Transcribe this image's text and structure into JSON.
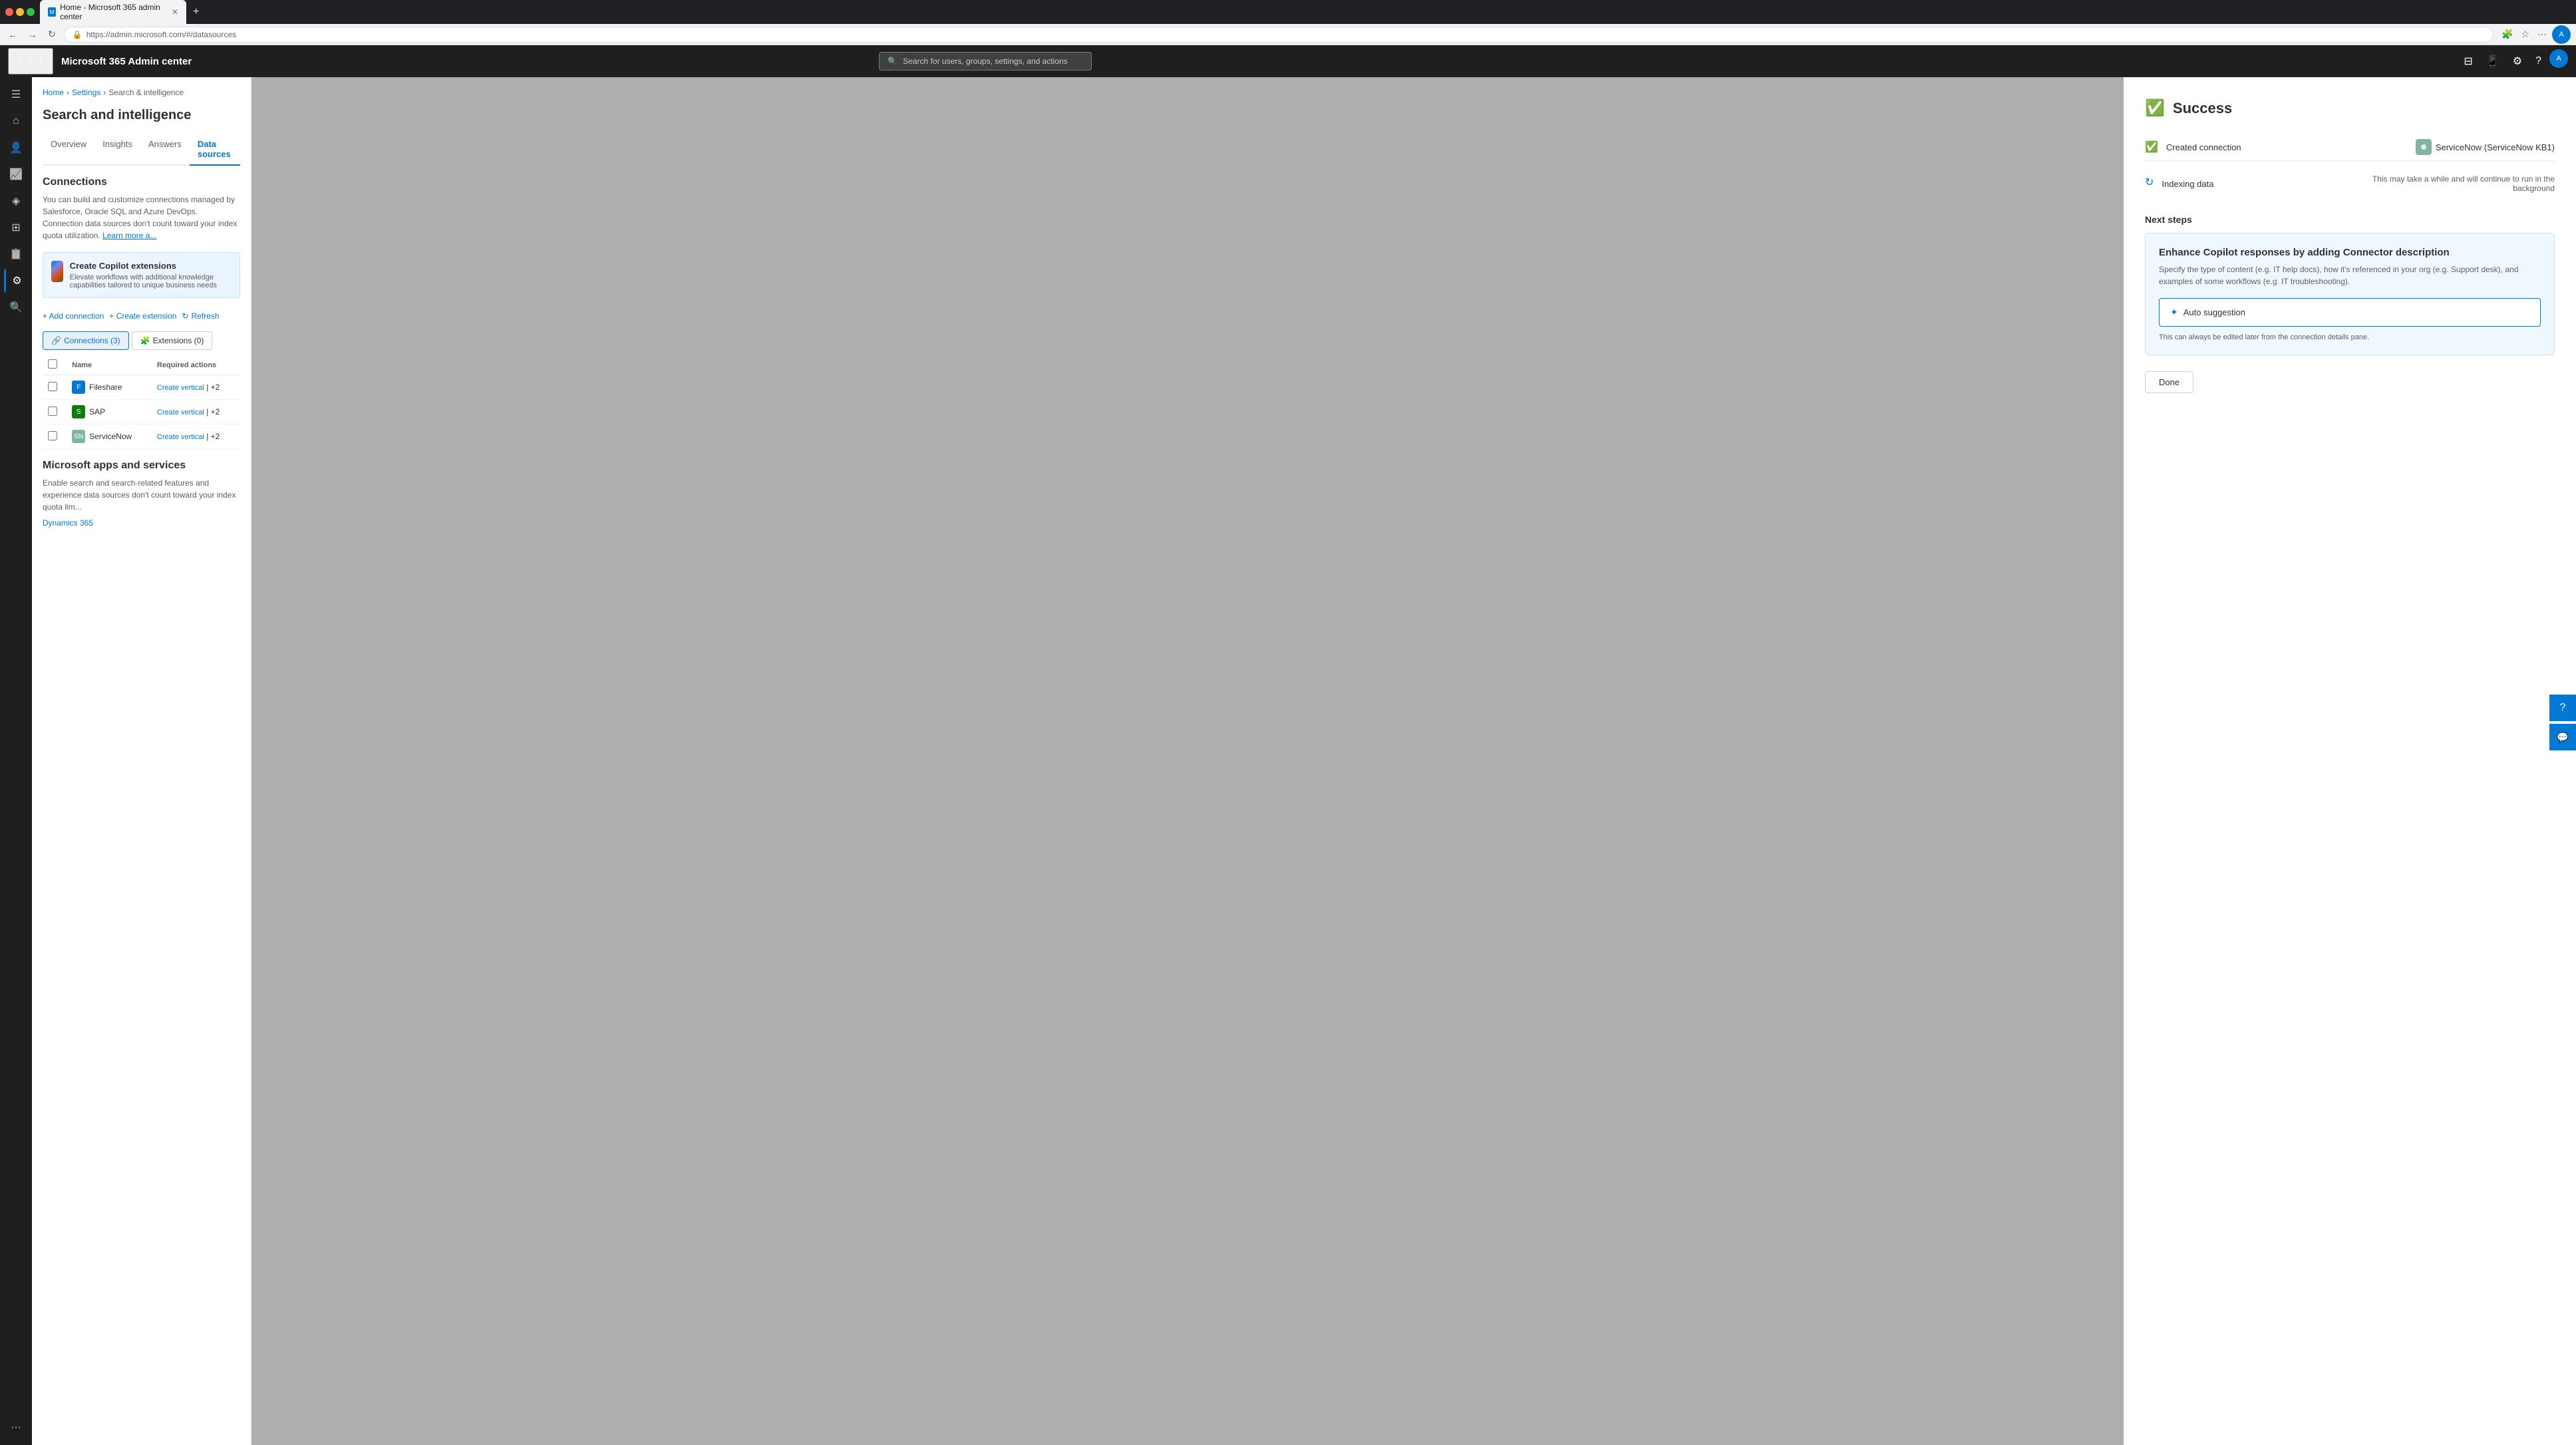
{
  "browser": {
    "url": "https://admin.microsoft.com/#/datasources",
    "tab_title": "Home - Microsoft 365 admin center",
    "tab_favicon": "M"
  },
  "top_nav": {
    "app_title": "Microsoft 365 Admin center",
    "search_placeholder": "Search for users, groups, settings, and actions",
    "avatar_initials": "A"
  },
  "breadcrumb": {
    "home": "Home",
    "settings": "Settings",
    "search_intelligence": "Search & intelligence"
  },
  "page": {
    "title": "Search and intelligence",
    "tabs": [
      {
        "label": "Overview",
        "active": false
      },
      {
        "label": "Insights",
        "active": false
      },
      {
        "label": "Answers",
        "active": false
      },
      {
        "label": "Data sources",
        "active": true
      }
    ]
  },
  "connections_section": {
    "title": "Connections",
    "description": "You can build and customize connections managed by Salesforce, Oracle SQL and Azure DevOps. Connection data sources don't count toward your index quota utilization.",
    "learn_more": "Learn more a..."
  },
  "promo_banner": {
    "title": "Create Copilot extensions",
    "description": "Elevate workflows with additional knowledge capabilities tailored to unique business needs"
  },
  "action_bar": {
    "add_connection": "+ Add connection",
    "create_extension": "+ Create extension",
    "refresh": "Refresh"
  },
  "sub_tabs": [
    {
      "label": "Connections (3)",
      "active": true
    },
    {
      "label": "Extensions (0)",
      "active": false
    }
  ],
  "table": {
    "headers": [
      "",
      "Name",
      "Required actions"
    ],
    "rows": [
      {
        "name": "Fileshare",
        "icon_color": "#0078d4",
        "icon_letter": "F",
        "action": "Create vertical",
        "action_extra": "| +2"
      },
      {
        "name": "SAP",
        "icon_color": "#107c10",
        "icon_letter": "S",
        "action": "Create vertical",
        "action_extra": "| +2"
      },
      {
        "name": "ServiceNow",
        "icon_color": "#81b5a1",
        "icon_letter": "SN",
        "action": "Create vertical",
        "action_extra": "| +2"
      }
    ]
  },
  "ms_apps": {
    "title": "Microsoft apps and services",
    "description": "Enable search and search-related features and experience data sources don't count toward your index quota lim...",
    "dynamics_link": "Dynamics 365"
  },
  "modal": {
    "success_title": "Success",
    "steps": [
      {
        "label": "Created connection",
        "status": "done",
        "value": "ServiceNow (ServiceNow KB1)"
      },
      {
        "label": "Indexing data",
        "status": "loading",
        "value": "This may take a while and will continue to run in the background"
      }
    ],
    "next_steps_title": "Next steps",
    "enhance_card": {
      "title": "Enhance Copilot responses by adding Connector description",
      "description": "Specify the type of content (e.g. IT help docs), how it's referenced in your org (e.g. Support desk), and examples of some workflows (e.g. IT troubleshooting).",
      "auto_suggestion_label": "✦ Auto suggestion",
      "edit_note": "This can always be edited later from the connection details pane."
    },
    "done_button": "Done"
  },
  "sidebar_icons": [
    {
      "name": "home",
      "symbol": "⌂"
    },
    {
      "name": "people",
      "symbol": "👤"
    },
    {
      "name": "analytics",
      "symbol": "📈"
    },
    {
      "name": "copilot",
      "symbol": "🤖"
    },
    {
      "name": "grid",
      "symbol": "⊞"
    },
    {
      "name": "reports",
      "symbol": "📊"
    },
    {
      "name": "settings",
      "symbol": "⚙"
    },
    {
      "name": "search",
      "symbol": "🔍"
    },
    {
      "name": "more",
      "symbol": "···"
    }
  ]
}
